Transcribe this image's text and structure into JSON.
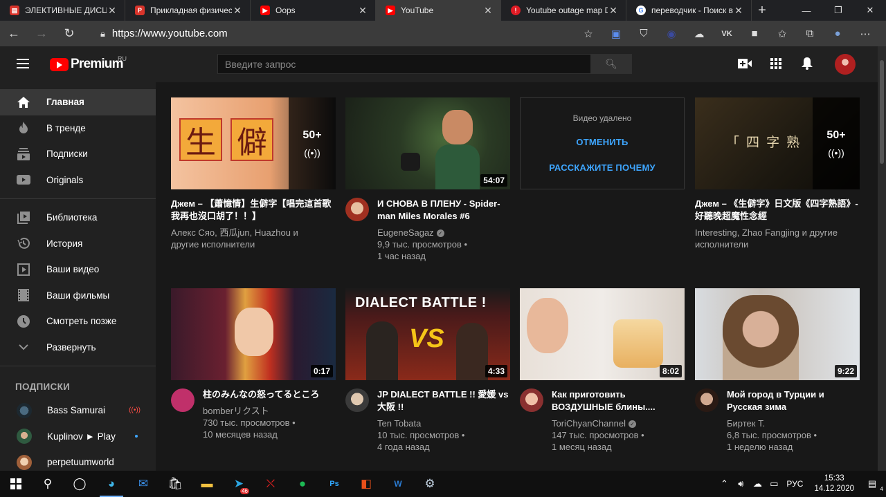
{
  "browser": {
    "tabs": [
      {
        "title": "ЭЛЕКТИВНЫЕ ДИСЦИПЛ",
        "icon": "document-icon",
        "color": "#d9342b",
        "active": false
      },
      {
        "title": "Прикладная физическ",
        "icon": "pdf-icon",
        "color": "#d9342b",
        "active": false
      },
      {
        "title": "Oops",
        "icon": "youtube-icon",
        "color": "#ff0000",
        "active": false
      },
      {
        "title": "YouTube",
        "icon": "youtube-icon",
        "color": "#ff0000",
        "active": true
      },
      {
        "title": "Youtube outage map D",
        "icon": "alert-icon",
        "color": "#e01b24",
        "active": false
      },
      {
        "title": "переводчик - Поиск в",
        "icon": "google-icon",
        "color": "#ffffff",
        "active": false
      }
    ],
    "url": "https://www.youtube.com"
  },
  "header": {
    "logo_text": "Premium",
    "region": "RU",
    "search_placeholder": "Введите запрос"
  },
  "sidebar": {
    "main_items": [
      {
        "label": "Главная",
        "icon": "home-icon",
        "active": true
      },
      {
        "label": "В тренде",
        "icon": "flame-icon",
        "active": false
      },
      {
        "label": "Подписки",
        "icon": "subscriptions-icon",
        "active": false
      },
      {
        "label": "Originals",
        "icon": "originals-icon",
        "active": false
      }
    ],
    "library_items": [
      {
        "label": "Библиотека",
        "icon": "library-icon"
      },
      {
        "label": "История",
        "icon": "history-icon"
      },
      {
        "label": "Ваши видео",
        "icon": "your-videos-icon"
      },
      {
        "label": "Ваши фильмы",
        "icon": "film-icon"
      },
      {
        "label": "Смотреть позже",
        "icon": "clock-icon"
      },
      {
        "label": "Развернуть",
        "icon": "chevron-down-icon"
      }
    ],
    "subs_heading": "ПОДПИСКИ",
    "subscriptions": [
      {
        "name": "Bass Samurai",
        "live": true,
        "new": false,
        "color": "#2a3a48"
      },
      {
        "name": "Kuplinov ► Play",
        "live": false,
        "new": true,
        "color": "#3d6b4a"
      },
      {
        "name": "perpetuumworld",
        "live": false,
        "new": false,
        "color": "#b07850"
      }
    ]
  },
  "videos_row1": [
    {
      "type": "mix",
      "title": "Джем – 【蕭憶情】生僻字【唱完這首歌我再也沒口胡了！！】",
      "line1": "Алекс Сяо, 西瓜jun, Huazhou и",
      "line2": "другие исполнители",
      "mix_count": "50+"
    },
    {
      "type": "video",
      "title": "И СНОВА В ПЛЕНУ - Spider-man Miles Morales #6",
      "channel": "EugeneSagaz",
      "verified": true,
      "views": "9,9 тыс. просмотров •",
      "age": "1 час назад",
      "duration": "54:07"
    },
    {
      "type": "removed",
      "text": "Видео удалено",
      "undo": "ОТМЕНИТЬ",
      "tell": "РАССКАЖИТЕ ПОЧЕМУ"
    },
    {
      "type": "mix",
      "title": "Джем – 《生僻字》日文版《四字熟語》-好聽晚超魔性念經",
      "line1": "Interesting, Zhao Fangjing и другие",
      "line2": "исполнители",
      "mix_count": "50+",
      "thumb_text": "「 四 字 熟"
    }
  ],
  "videos_row2": [
    {
      "title": "柱のみんなの怒ってるところ",
      "channel": "bomberリクスト",
      "verified": false,
      "views": "730 тыс. просмотров •",
      "age": "10 месяцев назад",
      "duration": "0:17"
    },
    {
      "title": "JP DIALECT BATTLE !! 愛媛 vs 大阪 !!",
      "channel": "Ten Tobata",
      "verified": false,
      "views": "10 тыс. просмотров •",
      "age": "4 года назад",
      "duration": "4:33",
      "thumb_text": "DIALECT BATTLE !",
      "thumb_vs": "VS"
    },
    {
      "title": "Как приготовить ВОЗДУШНЫЕ блины....",
      "channel": "ToriChyanChannel",
      "verified": true,
      "views": "147 тыс. просмотров •",
      "age": "1 месяц назад",
      "duration": "8:02"
    },
    {
      "title": "Мой город в Турции и Русская зима",
      "channel": "Биртек Т.",
      "verified": false,
      "views": "6,8 тыс. просмотров •",
      "age": "1 неделю назад",
      "duration": "9:22"
    }
  ],
  "thumb1_chars": [
    "生",
    "僻"
  ],
  "taskbar": {
    "telegram_badge": "46",
    "lang": "РУС",
    "time": "15:33",
    "date": "14.12.2020",
    "notif_count": "4"
  }
}
